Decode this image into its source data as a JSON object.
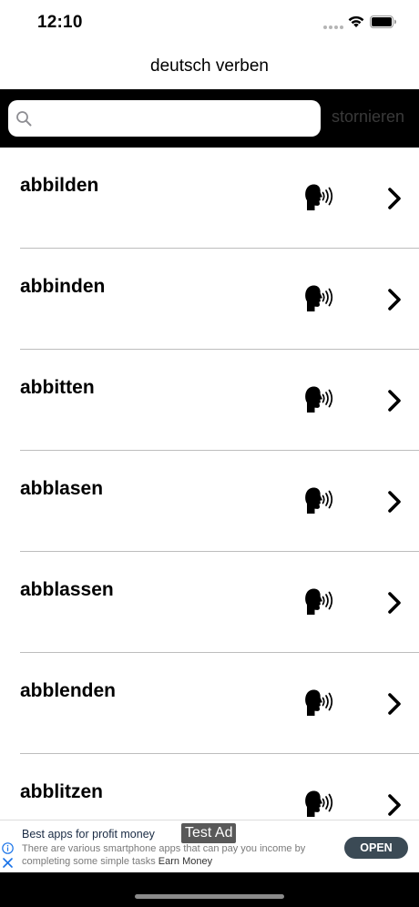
{
  "status_bar": {
    "time": "12:10"
  },
  "nav": {
    "title": "deutsch verben"
  },
  "search": {
    "placeholder": "",
    "value": "",
    "cancel_label": "stornieren"
  },
  "verbs": [
    {
      "label": "abbilden"
    },
    {
      "label": "abbinden"
    },
    {
      "label": "abbitten"
    },
    {
      "label": "abblasen"
    },
    {
      "label": "abblassen"
    },
    {
      "label": "abblenden"
    },
    {
      "label": "abblitzen"
    }
  ],
  "icons": {
    "speaker": "speaking-head-icon",
    "chevron": "chevron-right-icon",
    "search": "search-icon"
  },
  "ad": {
    "title": "Best apps for profit money",
    "tag": "Test Ad",
    "description": "There are various smartphone apps that can pay you income by completing some simple tasks",
    "source": "Earn Money",
    "open_label": "OPEN"
  },
  "colors": {
    "search_bar_bg": "#000000",
    "cancel_text": "#3a3a3a",
    "ad_button": "#3b4a55",
    "ad_info": "#1a73e8"
  }
}
